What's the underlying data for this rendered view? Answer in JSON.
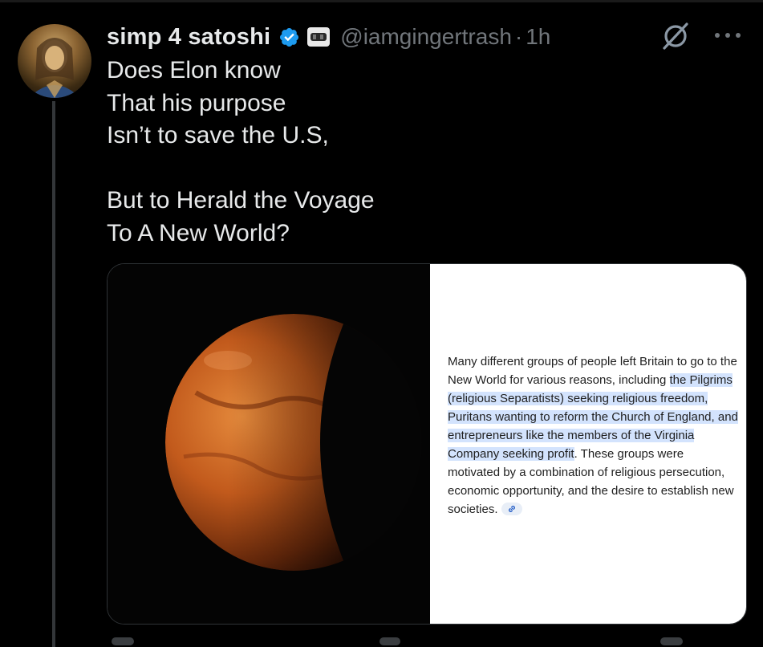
{
  "tweet": {
    "display_name": "simp 4 satoshi",
    "handle": "@iamgingertrash",
    "separator": "·",
    "timestamp": "1h",
    "text_lines": [
      "Does Elon know",
      "That his purpose",
      "Isn’t to save the U.S,",
      "",
      "But to Herald the Voyage",
      "To A New World?"
    ]
  },
  "icons": {
    "verified": "verified-badge-icon",
    "affiliate": "affiliate-badge-icon",
    "grok": "grok-icon",
    "more": "more-icon"
  },
  "media": {
    "ai_text_plain_before": "Many different groups of people left Britain to go to the New World for various reasons, including",
    "ai_text_highlighted": "the Pilgrims (religious Separatists) seeking religious freedom, Puritans wanting to reform the Church of England, and entrepreneurs like the members of the Virginia Company seeking profit",
    "ai_text_plain_after": ". These groups were motivated by a combination of religious persecution, economic opportunity, and the desire to establish new societies."
  },
  "colors": {
    "background": "#000000",
    "text": "#e7e9ea",
    "secondary": "#71767b",
    "verified": "#1d9bf0",
    "highlight": "#d3e3fd"
  }
}
